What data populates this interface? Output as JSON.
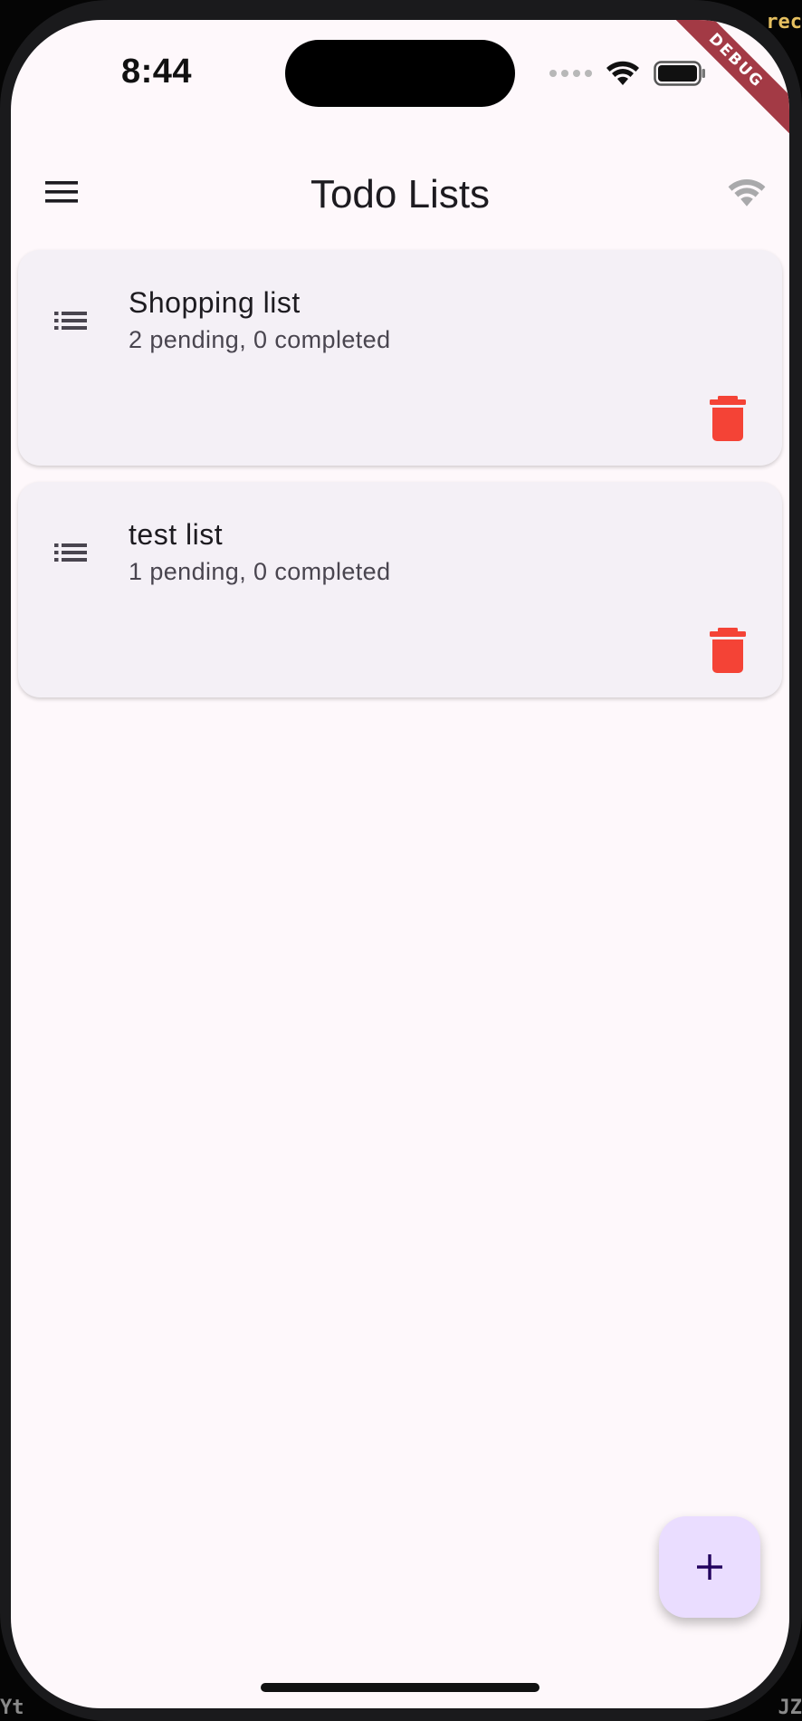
{
  "status_bar": {
    "time": "8:44",
    "debug_banner": "DEBUG"
  },
  "app_bar": {
    "title": "Todo Lists",
    "menu_icon": "hamburger-menu-icon",
    "connectivity_icon": "wifi-icon"
  },
  "lists": [
    {
      "title": "Shopping list",
      "summary": "2 pending, 0 completed",
      "icon": "list-icon",
      "action_icon": "trash-icon"
    },
    {
      "title": "test list",
      "summary": "1 pending, 0 completed",
      "icon": "list-icon",
      "action_icon": "trash-icon"
    }
  ],
  "fab": {
    "icon": "plus-icon"
  },
  "colors": {
    "background": "#fef8fb",
    "card": "#f4f0f6",
    "delete": "#f44336",
    "fab": "#eaddff",
    "fab_icon": "#21005d"
  },
  "edge_text": {
    "top_right": "rec",
    "bottom_left": "Yt",
    "bottom_right": "JZ"
  }
}
